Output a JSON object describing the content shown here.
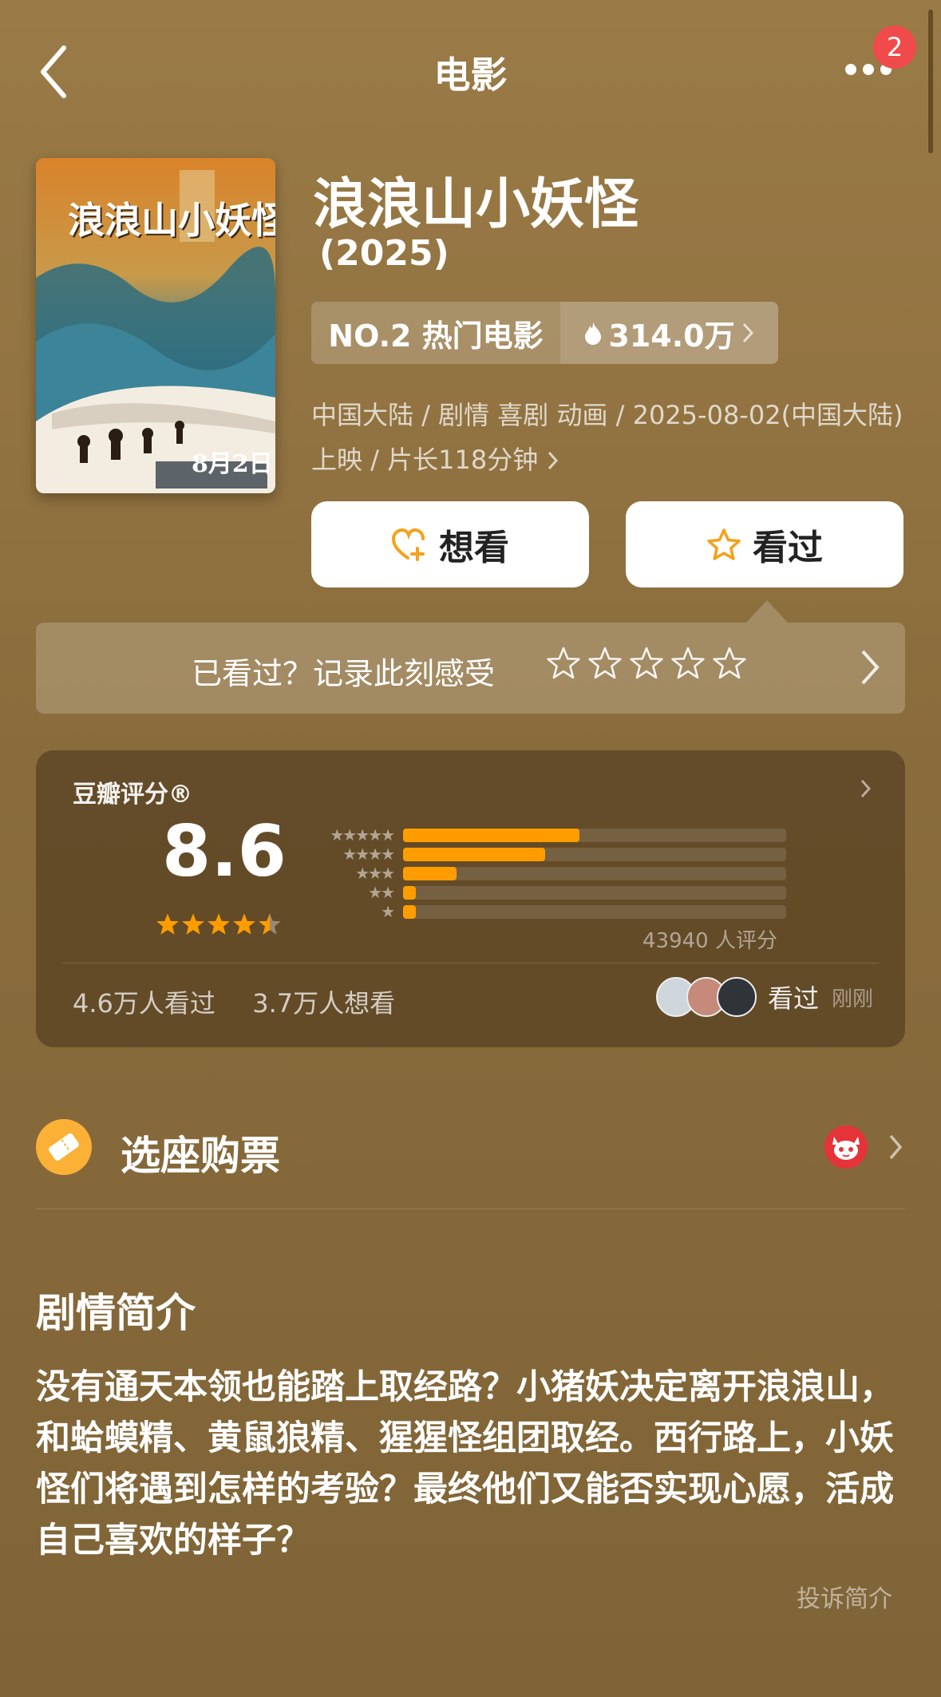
{
  "header": {
    "title": "电影",
    "notification_count": "2"
  },
  "poster": {
    "title_art": "浪浪山小妖怪",
    "date_art": "8月2日"
  },
  "movie": {
    "title": "浪浪山小妖怪",
    "year": "(2025)",
    "rank_label": "NO.2 热门电影",
    "heat_value": "314.0万",
    "meta": "中国大陆 / 剧情 喜剧 动画 / 2025-08-02(中国大陆) 上映 / 片长118分钟"
  },
  "actions": {
    "want_label": "想看",
    "seen_label": "看过"
  },
  "rate_prompt": {
    "text": "已看过？记录此刻感受"
  },
  "rating": {
    "label": "豆瓣评分®",
    "score": "8.6",
    "star_level": 4.5,
    "distribution": [
      {
        "stars": 5,
        "fraction": 0.46
      },
      {
        "stars": 4,
        "fraction": 0.37
      },
      {
        "stars": 3,
        "fraction": 0.14
      },
      {
        "stars": 2,
        "fraction": 0.03
      },
      {
        "stars": 1,
        "fraction": 0.03
      }
    ],
    "count_text": "43940 人评分",
    "watched_text": "4.6万人看过",
    "wishlist_text": "3.7万人想看",
    "friends_action": "看过",
    "friends_time": "刚刚"
  },
  "ticket": {
    "label": "选座购票"
  },
  "synopsis": {
    "heading": "剧情简介",
    "body": "没有通天本领也能踏上取经路？小猪妖决定离开浪浪山，和蛤蟆精、黄鼠狼精、猩猩怪组团取经。西行路上，小妖怪们将遇到怎样的考验？最终他们又能否实现心愿，活成自己喜欢的样子？",
    "complain_label": "投诉简介"
  },
  "colors": {
    "accent": "#ff9d00",
    "badge": "#f04a4a",
    "ticket": "#fbb036"
  }
}
